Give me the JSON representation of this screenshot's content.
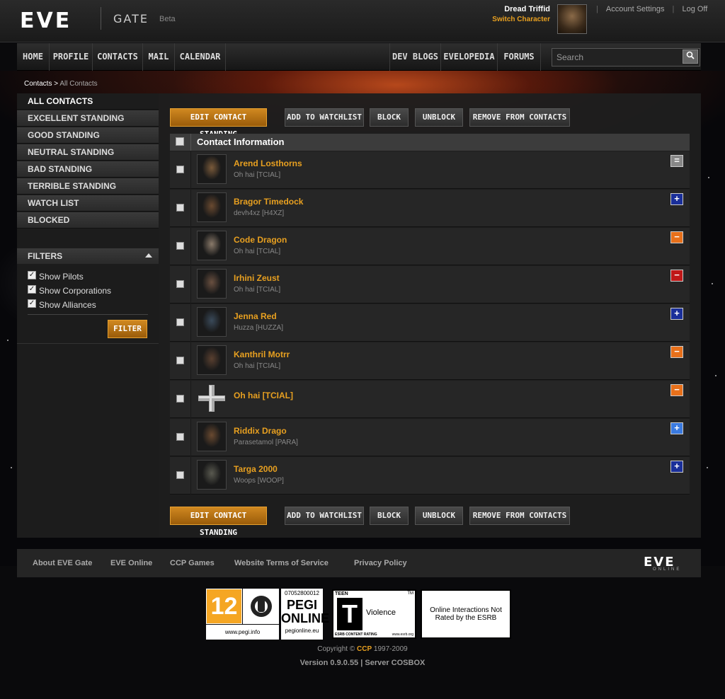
{
  "header": {
    "logo": "EVE",
    "gate": "GATE",
    "beta": "Beta",
    "character_name": "Dread Triffid",
    "switch_character": "Switch Character",
    "account_settings": "Account Settings",
    "log_off": "Log Off",
    "separator": "|"
  },
  "nav": {
    "left": [
      "HOME",
      "PROFILE",
      "CONTACTS",
      "MAIL",
      "CALENDAR"
    ],
    "right": [
      "DEV BLOGS",
      "EVELOPEDIA",
      "FORUMS"
    ],
    "search_placeholder": "Search"
  },
  "breadcrumb": {
    "root": "Contacts",
    "separator": ">",
    "current": "All Contacts"
  },
  "sidebar": {
    "items": [
      "ALL CONTACTS",
      "EXCELLENT STANDING",
      "GOOD STANDING",
      "NEUTRAL STANDING",
      "BAD STANDING",
      "TERRIBLE STANDING",
      "WATCH LIST",
      "BLOCKED"
    ],
    "active": "ALL CONTACTS"
  },
  "filters": {
    "title": "FILTERS",
    "options": [
      {
        "label": "Show Pilots",
        "checked": true
      },
      {
        "label": "Show Corporations",
        "checked": true
      },
      {
        "label": "Show Alliances",
        "checked": true
      }
    ],
    "button": "FILTER"
  },
  "actions": [
    "EDIT CONTACT STANDING",
    "ADD TO WATCHLIST",
    "BLOCK",
    "UNBLOCK",
    "REMOVE FROM CONTACTS"
  ],
  "table": {
    "header": "Contact Information",
    "rows": [
      {
        "name": "Arend Losthorns",
        "corp": "Oh hai [TCIAL]",
        "standing": "neutral",
        "symbol": "=",
        "color": "#888888",
        "portrait": "#7a5a3a"
      },
      {
        "name": "Bragor Timedock",
        "corp": "devh4xz [H4XZ]",
        "standing": "excellent",
        "symbol": "+",
        "color": "#1a2f9a",
        "portrait": "#6a4a30"
      },
      {
        "name": "Code Dragon",
        "corp": "Oh hai [TCIAL]",
        "standing": "bad",
        "symbol": "−",
        "color": "#e8701a",
        "portrait": "#8a7a6a"
      },
      {
        "name": "Irhini Zeust",
        "corp": "Oh hai [TCIAL]",
        "standing": "terrible",
        "symbol": "−",
        "color": "#c01818",
        "portrait": "#6a5040"
      },
      {
        "name": "Jenna Red",
        "corp": "Huzza [HUZZA]",
        "standing": "excellent",
        "symbol": "+",
        "color": "#1a2f9a",
        "portrait": "#3a4a5a"
      },
      {
        "name": "Kanthril Motrr",
        "corp": "Oh hai [TCIAL]",
        "standing": "bad",
        "symbol": "−",
        "color": "#e8701a",
        "portrait": "#5a4030"
      },
      {
        "name": "Oh hai [TCIAL]",
        "corp": "",
        "standing": "bad",
        "symbol": "−",
        "color": "#e8701a",
        "portrait": "corp"
      },
      {
        "name": "Riddix Drago",
        "corp": "Parasetamol [PARA]",
        "standing": "good",
        "symbol": "+",
        "color": "#3a7ae0",
        "portrait": "#6a4a30"
      },
      {
        "name": "Targa 2000",
        "corp": "Woops [WOOP]",
        "standing": "excellent",
        "symbol": "+",
        "color": "#1a2f9a",
        "portrait": "#5a5a50"
      }
    ]
  },
  "footer": {
    "links": [
      "About EVE Gate",
      "EVE Online",
      "CCP Games",
      "Website Terms of Service",
      "Privacy Policy"
    ],
    "logo": "EVE",
    "logo_sub": "ONLINE"
  },
  "ratings": {
    "pegi_age": "12",
    "pegi_url": "www.pegi.info",
    "pegi_number": "07052800012",
    "pegi_online": "PEGI ONLINE",
    "pegi_online_url": "pegionline.eu",
    "esrb_teen": "TEEN",
    "esrb_t": "T",
    "esrb_tm": "TM",
    "esrb_descriptor": "Violence",
    "esrb_content": "ESRB CONTENT RATING",
    "esrb_url": "www.esrb.org",
    "esrb_online": "Online Interactions Not Rated by the ESRB"
  },
  "copyright": {
    "prefix": "Copyright ©",
    "company": "CCP",
    "years": "1997-2009"
  },
  "version": "Version 0.9.0.55 | Server COSBOX"
}
